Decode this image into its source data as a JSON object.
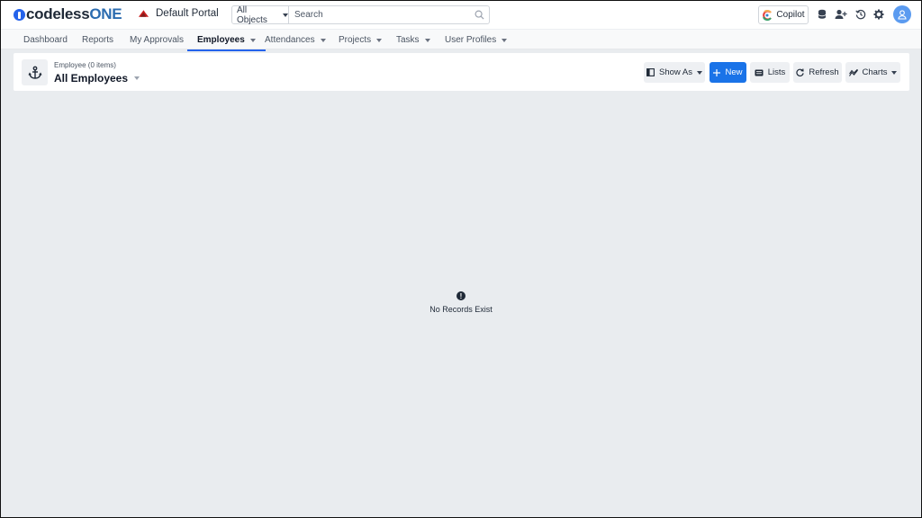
{
  "app": {
    "logo_text_main": "codeless",
    "logo_text_accent": "ONE",
    "portal_label": "Default Portal"
  },
  "search": {
    "scope_selected": "All Objects",
    "placeholder": "Search"
  },
  "header_actions": {
    "copilot_label": "Copilot",
    "icons": [
      "database-icon",
      "add-user-icon",
      "history-icon",
      "gear-icon",
      "user-avatar-icon"
    ]
  },
  "nav": {
    "items": [
      {
        "label": "Dashboard",
        "dropdown": false
      },
      {
        "label": "Reports",
        "dropdown": false
      },
      {
        "label": "My Approvals",
        "dropdown": false
      },
      {
        "label": "Employees",
        "dropdown": true,
        "active": true
      },
      {
        "label": "Attendances",
        "dropdown": true
      },
      {
        "label": "Projects",
        "dropdown": true
      },
      {
        "label": "Tasks",
        "dropdown": true
      },
      {
        "label": "User Profiles",
        "dropdown": true
      }
    ]
  },
  "list_header": {
    "entity_label": "Employee (0 items)",
    "view_name": "All Employees",
    "icon": "anchor-icon"
  },
  "toolbar": {
    "show_as_label": "Show As",
    "new_label": "New",
    "lists_label": "Lists",
    "refresh_label": "Refresh",
    "charts_label": "Charts"
  },
  "empty_state": {
    "icon_glyph": "!",
    "message": "No Records Exist"
  },
  "colors": {
    "primary": "#1a73e8",
    "active_tab_underline": "#2563eb",
    "page_background": "#e9ecef",
    "avatar": "#5b9bf0"
  }
}
